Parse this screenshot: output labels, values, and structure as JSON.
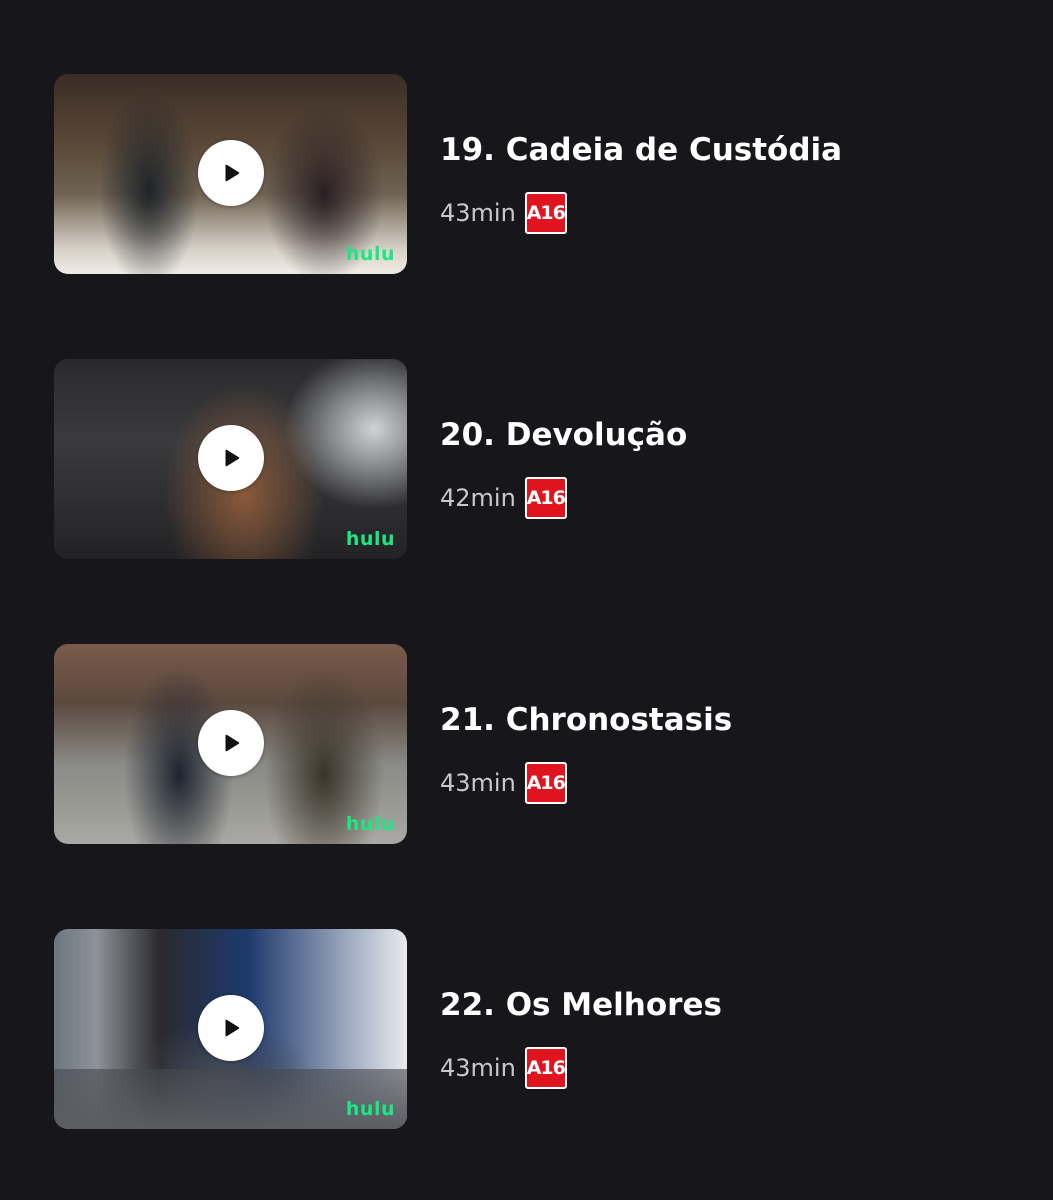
{
  "episodes": [
    {
      "title": "19. Cadeia de Custódia",
      "duration": "43min",
      "rating": "A16",
      "brand": "hulu"
    },
    {
      "title": "20. Devolução",
      "duration": "42min",
      "rating": "A16",
      "brand": "hulu"
    },
    {
      "title": "21. Chronostasis",
      "duration": "43min",
      "rating": "A16",
      "brand": "hulu"
    },
    {
      "title": "22. Os Melhores",
      "duration": "43min",
      "rating": "A16",
      "brand": "hulu"
    }
  ],
  "icons": {
    "play": "play-icon"
  },
  "colors": {
    "background": "#17161b",
    "rating_badge": "#e0141f",
    "brand": "#1ce783",
    "duration_text": "#c9c9cc"
  }
}
